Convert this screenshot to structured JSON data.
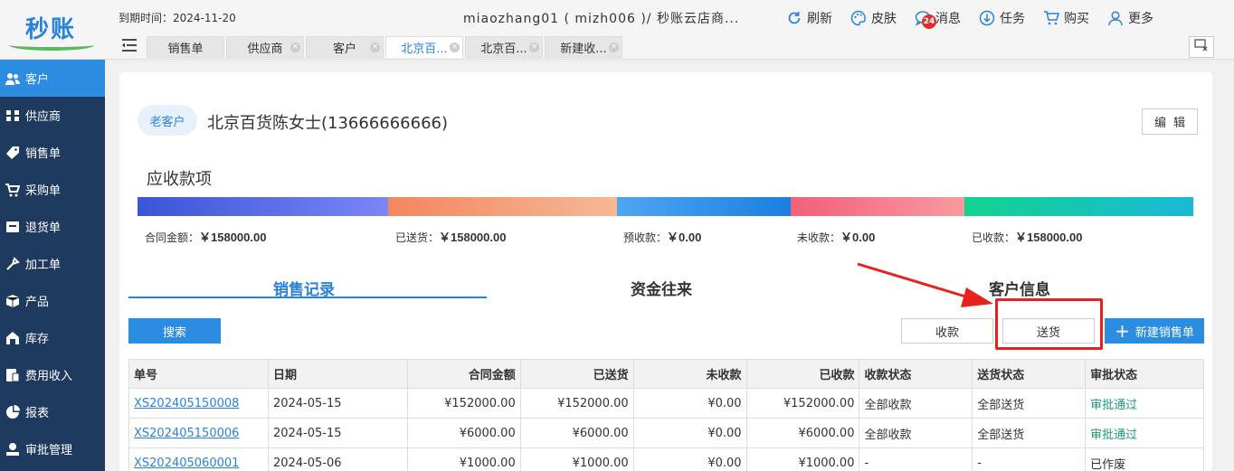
{
  "app": {
    "logo": "秒账"
  },
  "header": {
    "expire": "到期时间：2024-11-20",
    "account": "miaozhang01 ( mizh006 )/ 秒账云店商...",
    "actions": [
      {
        "label": "刷新",
        "icon": "refresh-icon"
      },
      {
        "label": "皮肤",
        "icon": "palette-icon"
      },
      {
        "label": "消息",
        "icon": "message-icon",
        "badge": "24"
      },
      {
        "label": "任务",
        "icon": "task-icon"
      },
      {
        "label": "购买",
        "icon": "cart-icon"
      },
      {
        "label": "更多",
        "icon": "user-icon"
      }
    ]
  },
  "tabs": [
    {
      "label": "销售单",
      "closable": false
    },
    {
      "label": "供应商",
      "closable": true
    },
    {
      "label": "客户",
      "closable": true
    },
    {
      "label": "北京百...",
      "closable": true,
      "active": true
    },
    {
      "label": "北京百...",
      "closable": true
    },
    {
      "label": "新建收...",
      "closable": true
    }
  ],
  "sidebar": {
    "items": [
      {
        "label": "客户",
        "icon": "users-icon",
        "active": true
      },
      {
        "label": "供应商",
        "icon": "supplier-icon"
      },
      {
        "label": "销售单",
        "icon": "tag-icon"
      },
      {
        "label": "采购单",
        "icon": "cart-icon"
      },
      {
        "label": "退货单",
        "icon": "return-icon"
      },
      {
        "label": "加工单",
        "icon": "process-icon"
      },
      {
        "label": "产品",
        "icon": "box-icon"
      },
      {
        "label": "库存",
        "icon": "warehouse-icon"
      },
      {
        "label": "费用收入",
        "icon": "money-icon"
      },
      {
        "label": "报表",
        "icon": "pie-chart-icon"
      },
      {
        "label": "审批管理",
        "icon": "approval-icon"
      }
    ]
  },
  "customer": {
    "tag": "老客户",
    "name": "北京百货陈女士(13666666666)",
    "edit": "编辑"
  },
  "receivables": {
    "title": "应收款项",
    "items": [
      {
        "label": "合同金额：",
        "value": "￥158000.00"
      },
      {
        "label": "已送货：",
        "value": "￥158000.00"
      },
      {
        "label": "预收款：",
        "value": "￥0.00"
      },
      {
        "label": "未收款：",
        "value": "￥0.00"
      },
      {
        "label": "已收款：",
        "value": "￥158000.00"
      }
    ]
  },
  "sections": {
    "sales": "销售记录",
    "funds": "资金往来",
    "info": "客户信息"
  },
  "buttons": {
    "search": "搜索",
    "receive": "收款",
    "deliver": "送货",
    "new_sale": "新建销售单"
  },
  "table": {
    "headers": [
      "单号",
      "日期",
      "合同金额",
      "已送货",
      "未收款",
      "已收款",
      "收款状态",
      "送货状态",
      "审批状态"
    ],
    "rows": [
      [
        "XS202405150008",
        "2024-05-15",
        "¥152000.00",
        "¥152000.00",
        "¥0.00",
        "¥152000.00",
        "全部收款",
        "全部送货",
        "审批通过"
      ],
      [
        "XS202405150006",
        "2024-05-15",
        "¥6000.00",
        "¥6000.00",
        "¥0.00",
        "¥6000.00",
        "全部收款",
        "全部送货",
        "审批通过"
      ],
      [
        "XS202405060001",
        "2024-05-06",
        "¥1000.00",
        "¥1000.00",
        "¥0.00",
        "¥1000.00",
        "-",
        "-",
        "已作废"
      ]
    ]
  },
  "colors": {
    "accent": "#2b8ce0",
    "sidebar": "#1f3a5f",
    "highlight": "#e8201e",
    "approved": "#1d9a7a"
  }
}
